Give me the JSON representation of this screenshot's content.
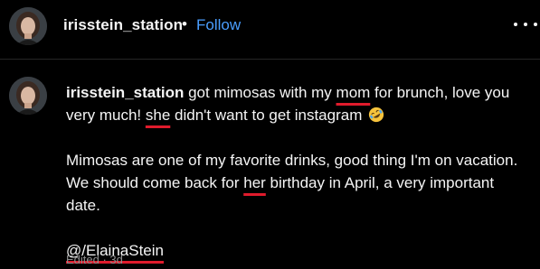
{
  "header": {
    "username": "irisstein_station",
    "separator": "•",
    "follow_label": "Follow",
    "more_icon": "more-horizontal-icon"
  },
  "post": {
    "username": "irisstein_station",
    "line1": {
      "pre": " got mimosas with my ",
      "mom": "mom",
      "post": " for brunch, love you very much! ",
      "she": "she",
      "tail": " didn't want to get instagram "
    },
    "emoji_icon": "rolling-on-floor-laughing-icon",
    "para2": {
      "pre": "Mimosas are one of my favorite drinks, good thing I'm on vacation. We should come back for ",
      "her": "her",
      "tail": " birthday in April, a very important date."
    },
    "mention": "@/ElainaStein",
    "meta": "Edited · 3d"
  },
  "colors": {
    "background": "#000000",
    "text": "#f5f5f5",
    "follow": "#4a9eff",
    "underline": "#e01b2c",
    "muted": "#8e8e8e"
  }
}
